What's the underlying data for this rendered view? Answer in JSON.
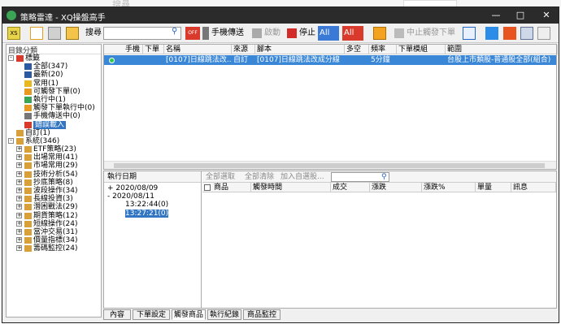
{
  "background": {
    "ghost_text": "搜尋"
  },
  "window": {
    "title": "策略雷達 - XQ操盤高手"
  },
  "toolbar": {
    "search_label": "搜尋",
    "manual_send": "手機傳送",
    "start": "啟動",
    "stop": "停止",
    "all_on": "All",
    "all_off": "All",
    "stop_order": "中止觸發下單"
  },
  "left_panel": {
    "header": "目錄分類",
    "tree": [
      {
        "label": "標籤",
        "indent": 0,
        "expander": "-",
        "icon": "tag"
      },
      {
        "label": "全部(347)",
        "indent": 1,
        "expander": "",
        "icon": "all"
      },
      {
        "label": "最新(20)",
        "indent": 1,
        "expander": "",
        "icon": "new"
      },
      {
        "label": "常用(1)",
        "indent": 1,
        "expander": "",
        "icon": "star"
      },
      {
        "label": "可觸發下單(0)",
        "indent": 1,
        "expander": "",
        "icon": "order"
      },
      {
        "label": "執行中(1)",
        "indent": 1,
        "expander": "",
        "icon": "run"
      },
      {
        "label": "觸發下單執行中(0)",
        "indent": 1,
        "expander": "",
        "icon": "order-run"
      },
      {
        "label": "手機傳送中(0)",
        "indent": 1,
        "expander": "",
        "icon": "phone"
      },
      {
        "label": "錯誤載入",
        "indent": 1,
        "expander": "",
        "icon": "error",
        "selected": true
      },
      {
        "label": "自訂(1)",
        "indent": 0,
        "expander": "",
        "icon": "folder"
      },
      {
        "label": "系統(346)",
        "indent": 0,
        "expander": "-",
        "icon": "folder"
      },
      {
        "label": "ETF策略(23)",
        "indent": 1,
        "expander": "+",
        "icon": "folder"
      },
      {
        "label": "出場常用(41)",
        "indent": 1,
        "expander": "+",
        "icon": "folder"
      },
      {
        "label": "市場常用(29)",
        "indent": 1,
        "expander": "+",
        "icon": "folder"
      },
      {
        "label": "技術分析(54)",
        "indent": 1,
        "expander": "+",
        "icon": "folder"
      },
      {
        "label": "抄底策略(8)",
        "indent": 1,
        "expander": "+",
        "icon": "folder"
      },
      {
        "label": "波段操作(34)",
        "indent": 1,
        "expander": "+",
        "icon": "folder"
      },
      {
        "label": "長線投資(3)",
        "indent": 1,
        "expander": "+",
        "icon": "folder"
      },
      {
        "label": "潛困戰法(29)",
        "indent": 1,
        "expander": "+",
        "icon": "folder"
      },
      {
        "label": "期貨策略(12)",
        "indent": 1,
        "expander": "+",
        "icon": "folder"
      },
      {
        "label": "短線操作(24)",
        "indent": 1,
        "expander": "+",
        "icon": "folder"
      },
      {
        "label": "當沖交易(31)",
        "indent": 1,
        "expander": "+",
        "icon": "folder"
      },
      {
        "label": "價量指標(34)",
        "indent": 1,
        "expander": "+",
        "icon": "folder"
      },
      {
        "label": "籌碼監控(24)",
        "indent": 1,
        "expander": "+",
        "icon": "folder"
      }
    ]
  },
  "strategy_table": {
    "columns": [
      "手機",
      "下單",
      "名稱",
      "來源",
      "腳本",
      "多空",
      "頻率",
      "下單模組",
      "範圍"
    ],
    "rows": [
      {
        "status": "running",
        "mobile": "",
        "order": "",
        "name": "[0107]日線跳法改...",
        "source": "自訂",
        "script": "[0107]日線跳法改成分線",
        "direction": "",
        "frequency": "5分鐘",
        "order_module": "",
        "scope": "台股上市類股-普通股全部(組合)"
      }
    ]
  },
  "execution": {
    "header": "執行日期",
    "dates": [
      {
        "label": "2020/08/09",
        "expander": "+"
      },
      {
        "label": "2020/08/11",
        "expander": "-",
        "children": [
          {
            "label": "13:22:44(0)",
            "selected": false
          },
          {
            "label": "13:27:21(0)",
            "selected": true
          }
        ]
      }
    ]
  },
  "results": {
    "select_all": "全部選取",
    "clear_all": "全部清除",
    "add_to_watch": "加入自選股...",
    "columns": [
      "商品",
      "觸發時間",
      "成交",
      "漲跌",
      "漲跌%",
      "單量",
      "訊息"
    ]
  },
  "tabs": [
    {
      "label": "內容",
      "active": false
    },
    {
      "label": "下單設定",
      "active": false
    },
    {
      "label": "觸發商品",
      "active": true
    },
    {
      "label": "執行紀錄",
      "active": false
    },
    {
      "label": "商品監控",
      "active": false
    }
  ],
  "colors": {
    "selection": "#3a87d8",
    "titlebar": "#2b2b2b",
    "panel_bg": "#f0f0f0",
    "status_green": "#2ec84a"
  }
}
